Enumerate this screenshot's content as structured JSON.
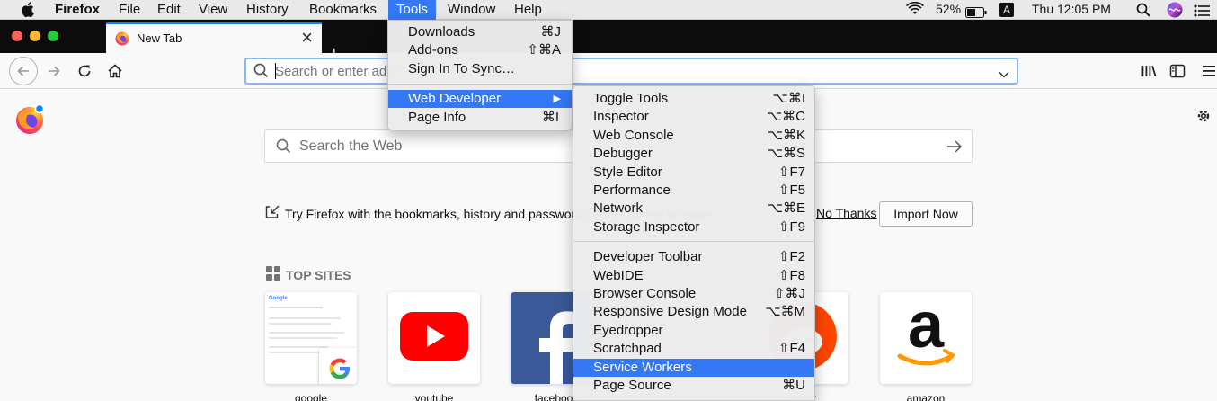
{
  "menubar": {
    "items": [
      "Firefox",
      "File",
      "Edit",
      "View",
      "History",
      "Bookmarks",
      "Tools",
      "Window",
      "Help"
    ],
    "battery": "52%",
    "input_source": "A",
    "clock": "Thu 12:05 PM"
  },
  "tab": {
    "title": "New Tab"
  },
  "urlbar": {
    "placeholder": "Search or enter address"
  },
  "newtab": {
    "search_placeholder": "Search the Web",
    "import_text": "Try Firefox with the bookmarks, history and passwords from another browser.",
    "no_thanks": "No Thanks",
    "import_button": "Import Now",
    "top_sites_heading": "TOP SITES",
    "top_sites": [
      "google",
      "youtube",
      "facebook",
      "",
      "reddit",
      "amazon"
    ]
  },
  "tools_menu": {
    "items": [
      {
        "label": "Downloads",
        "shortcut": "⌘J"
      },
      {
        "label": "Add-ons",
        "shortcut": "⇧⌘A"
      },
      {
        "label": "Sign In To Sync…",
        "shortcut": ""
      },
      {
        "label": "Web Developer",
        "shortcut": "▶"
      },
      {
        "label": "Page Info",
        "shortcut": "⌘I"
      }
    ]
  },
  "webdev_menu": {
    "items": [
      {
        "label": "Toggle Tools",
        "shortcut": "⌥⌘I"
      },
      {
        "label": "Inspector",
        "shortcut": "⌥⌘C"
      },
      {
        "label": "Web Console",
        "shortcut": "⌥⌘K"
      },
      {
        "label": "Debugger",
        "shortcut": "⌥⌘S"
      },
      {
        "label": "Style Editor",
        "shortcut": "⇧F7"
      },
      {
        "label": "Performance",
        "shortcut": "⇧F5"
      },
      {
        "label": "Network",
        "shortcut": "⌥⌘E"
      },
      {
        "label": "Storage Inspector",
        "shortcut": "⇧F9"
      },
      {
        "label": "Developer Toolbar",
        "shortcut": "⇧F2"
      },
      {
        "label": "WebIDE",
        "shortcut": "⇧F8"
      },
      {
        "label": "Browser Console",
        "shortcut": "⇧⌘J"
      },
      {
        "label": "Responsive Design Mode",
        "shortcut": "⌥⌘M"
      },
      {
        "label": "Eyedropper",
        "shortcut": ""
      },
      {
        "label": "Scratchpad",
        "shortcut": "⇧F4"
      },
      {
        "label": "Service Workers",
        "shortcut": ""
      },
      {
        "label": "Page Source",
        "shortcut": "⌘U"
      }
    ]
  }
}
